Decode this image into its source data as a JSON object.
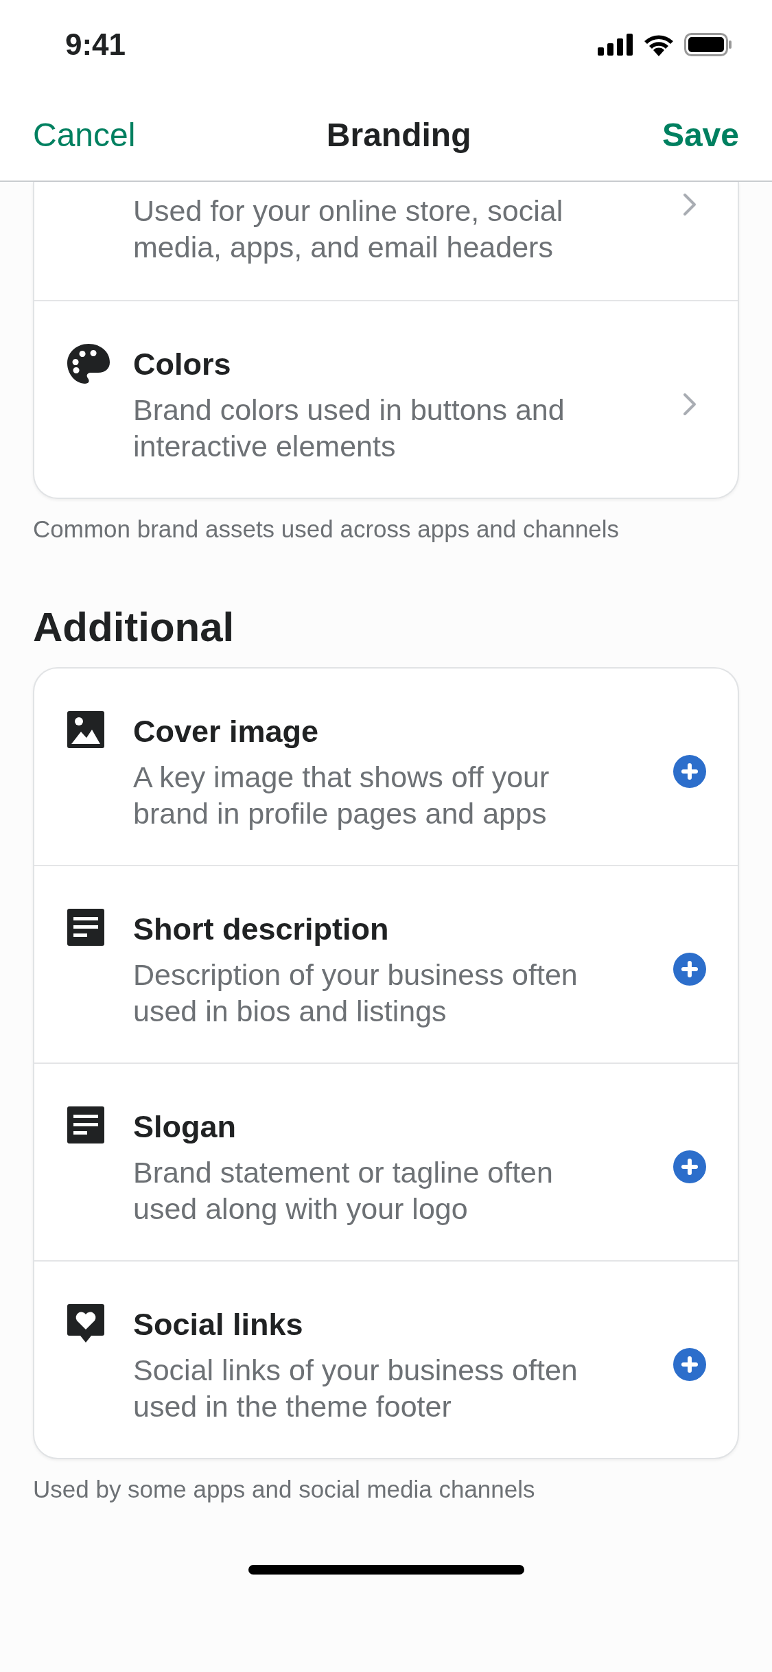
{
  "status_bar": {
    "time": "9:41"
  },
  "nav": {
    "cancel": "Cancel",
    "title": "Branding",
    "save": "Save"
  },
  "sections": [
    {
      "kind": "link",
      "footer": "Common brand assets used across apps and channels",
      "items": [
        {
          "description": "Used for your online store, social media, apps, and email headers"
        },
        {
          "kind": "palette",
          "title": "Colors",
          "description": "Brand colors used in buttons and interactive elements"
        }
      ]
    },
    {
      "kind": "add",
      "heading": "Additional",
      "footer": "Used by some apps and social media channels",
      "items": [
        {
          "kind": "image",
          "title": "Cover image",
          "description": "A key image that shows off your brand in profile pages and apps"
        },
        {
          "kind": "document",
          "title": "Short description",
          "description": "Description of your business often used in bios and listings"
        },
        {
          "kind": "document",
          "title": "Slogan",
          "description": "Brand statement or tagline often used along with your logo"
        },
        {
          "kind": "heart",
          "title": "Social links",
          "description": "Social links of your business often used in the theme footer"
        }
      ]
    }
  ]
}
